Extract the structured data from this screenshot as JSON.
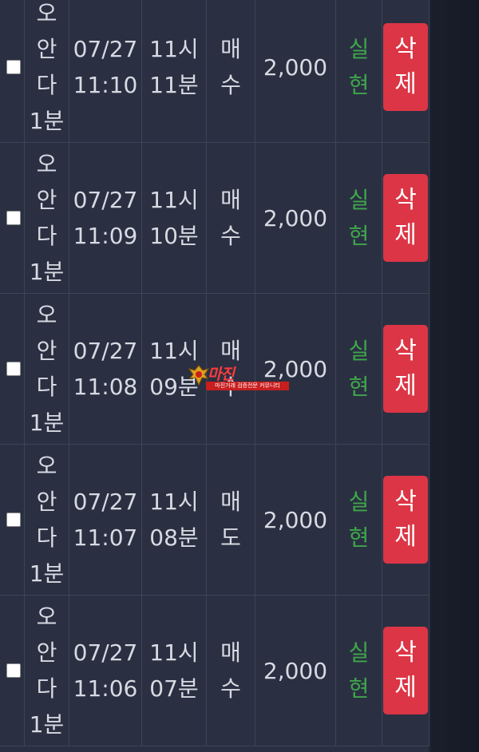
{
  "rows": [
    {
      "name": [
        "오",
        "안",
        "다",
        "1분"
      ],
      "date": "07/27",
      "time": "11:10",
      "round": [
        "11시",
        "11분"
      ],
      "side": [
        "매",
        "수"
      ],
      "amount": "2,000",
      "type": [
        "실",
        "현"
      ],
      "delete": [
        "삭",
        "제"
      ]
    },
    {
      "name": [
        "오",
        "안",
        "다",
        "1분"
      ],
      "date": "07/27",
      "time": "11:09",
      "round": [
        "11시",
        "10분"
      ],
      "side": [
        "매",
        "수"
      ],
      "amount": "2,000",
      "type": [
        "실",
        "현"
      ],
      "delete": [
        "삭",
        "제"
      ]
    },
    {
      "name": [
        "오",
        "안",
        "다",
        "1분"
      ],
      "date": "07/27",
      "time": "11:08",
      "round": [
        "11시",
        "09분"
      ],
      "side": [
        "매",
        "수"
      ],
      "amount": "2,000",
      "type": [
        "실",
        "현"
      ],
      "delete": [
        "삭",
        "제"
      ]
    },
    {
      "name": [
        "오",
        "안",
        "다",
        "1분"
      ],
      "date": "07/27",
      "time": "11:07",
      "round": [
        "11시",
        "08분"
      ],
      "side": [
        "매",
        "도"
      ],
      "amount": "2,000",
      "type": [
        "실",
        "현"
      ],
      "delete": [
        "삭",
        "제"
      ]
    },
    {
      "name": [
        "오",
        "안",
        "다",
        "1분"
      ],
      "date": "07/27",
      "time": "11:06",
      "round": [
        "11시",
        "07분"
      ],
      "side": [
        "매",
        "수"
      ],
      "amount": "2,000",
      "type": [
        "실",
        "현"
      ],
      "delete": [
        "삭",
        "제"
      ]
    }
  ],
  "colors": {
    "background": "#2a3042",
    "text": "#d7dae2",
    "type_text": "#3fa64a",
    "delete_button": "#dc3545",
    "grid": "#3d4458"
  },
  "watermark": {
    "title": "마진",
    "subtitle": "마진거래 검증전문 커뮤니티"
  }
}
